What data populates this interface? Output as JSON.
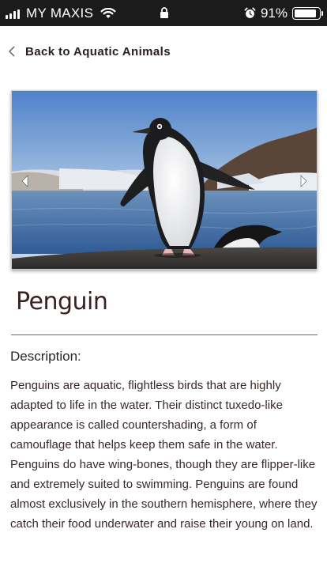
{
  "status_bar": {
    "carrier": "MY MAXIS",
    "battery_percent": "91%",
    "battery_level": 0.91,
    "icons": [
      "signal-icon",
      "wifi-icon",
      "lock-icon",
      "alarm-icon",
      "battery-icon"
    ]
  },
  "nav": {
    "back_label": "Back to Aquatic Animals"
  },
  "carousel": {
    "image_subject": "penguin-photo",
    "prev_icon": "caret-left-icon",
    "next_icon": "caret-right-icon"
  },
  "animal": {
    "name": "Penguin",
    "description_label": "Description:",
    "description": "Penguins are aquatic, flightless birds that are highly adapted to life in the water. Their distinct tuxedo-like appearance is called countershading, a form of camouflage that helps keep them safe in the water. Penguins do have wing-bones, though they are flipper-like and extremely suited to swimming. Penguins are found almost exclusively in the southern hemisphere, where they catch their food underwater and raise their young on land."
  },
  "colors": {
    "status_bar_bg": "#1b1b1b",
    "text_dark": "#3a2828",
    "divider": "#6a6a6a"
  }
}
